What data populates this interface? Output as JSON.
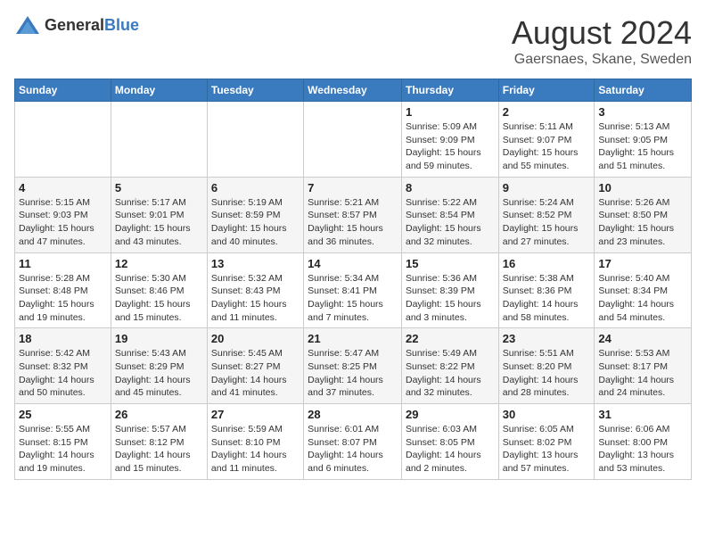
{
  "header": {
    "logo": {
      "general": "General",
      "blue": "Blue"
    },
    "title": "August 2024",
    "subtitle": "Gaersnaes, Skane, Sweden"
  },
  "calendar": {
    "days_of_week": [
      "Sunday",
      "Monday",
      "Tuesday",
      "Wednesday",
      "Thursday",
      "Friday",
      "Saturday"
    ],
    "weeks": [
      [
        {
          "day": "",
          "info": ""
        },
        {
          "day": "",
          "info": ""
        },
        {
          "day": "",
          "info": ""
        },
        {
          "day": "",
          "info": ""
        },
        {
          "day": "1",
          "info": "Sunrise: 5:09 AM\nSunset: 9:09 PM\nDaylight: 15 hours\nand 59 minutes."
        },
        {
          "day": "2",
          "info": "Sunrise: 5:11 AM\nSunset: 9:07 PM\nDaylight: 15 hours\nand 55 minutes."
        },
        {
          "day": "3",
          "info": "Sunrise: 5:13 AM\nSunset: 9:05 PM\nDaylight: 15 hours\nand 51 minutes."
        }
      ],
      [
        {
          "day": "4",
          "info": "Sunrise: 5:15 AM\nSunset: 9:03 PM\nDaylight: 15 hours\nand 47 minutes."
        },
        {
          "day": "5",
          "info": "Sunrise: 5:17 AM\nSunset: 9:01 PM\nDaylight: 15 hours\nand 43 minutes."
        },
        {
          "day": "6",
          "info": "Sunrise: 5:19 AM\nSunset: 8:59 PM\nDaylight: 15 hours\nand 40 minutes."
        },
        {
          "day": "7",
          "info": "Sunrise: 5:21 AM\nSunset: 8:57 PM\nDaylight: 15 hours\nand 36 minutes."
        },
        {
          "day": "8",
          "info": "Sunrise: 5:22 AM\nSunset: 8:54 PM\nDaylight: 15 hours\nand 32 minutes."
        },
        {
          "day": "9",
          "info": "Sunrise: 5:24 AM\nSunset: 8:52 PM\nDaylight: 15 hours\nand 27 minutes."
        },
        {
          "day": "10",
          "info": "Sunrise: 5:26 AM\nSunset: 8:50 PM\nDaylight: 15 hours\nand 23 minutes."
        }
      ],
      [
        {
          "day": "11",
          "info": "Sunrise: 5:28 AM\nSunset: 8:48 PM\nDaylight: 15 hours\nand 19 minutes."
        },
        {
          "day": "12",
          "info": "Sunrise: 5:30 AM\nSunset: 8:46 PM\nDaylight: 15 hours\nand 15 minutes."
        },
        {
          "day": "13",
          "info": "Sunrise: 5:32 AM\nSunset: 8:43 PM\nDaylight: 15 hours\nand 11 minutes."
        },
        {
          "day": "14",
          "info": "Sunrise: 5:34 AM\nSunset: 8:41 PM\nDaylight: 15 hours\nand 7 minutes."
        },
        {
          "day": "15",
          "info": "Sunrise: 5:36 AM\nSunset: 8:39 PM\nDaylight: 15 hours\nand 3 minutes."
        },
        {
          "day": "16",
          "info": "Sunrise: 5:38 AM\nSunset: 8:36 PM\nDaylight: 14 hours\nand 58 minutes."
        },
        {
          "day": "17",
          "info": "Sunrise: 5:40 AM\nSunset: 8:34 PM\nDaylight: 14 hours\nand 54 minutes."
        }
      ],
      [
        {
          "day": "18",
          "info": "Sunrise: 5:42 AM\nSunset: 8:32 PM\nDaylight: 14 hours\nand 50 minutes."
        },
        {
          "day": "19",
          "info": "Sunrise: 5:43 AM\nSunset: 8:29 PM\nDaylight: 14 hours\nand 45 minutes."
        },
        {
          "day": "20",
          "info": "Sunrise: 5:45 AM\nSunset: 8:27 PM\nDaylight: 14 hours\nand 41 minutes."
        },
        {
          "day": "21",
          "info": "Sunrise: 5:47 AM\nSunset: 8:25 PM\nDaylight: 14 hours\nand 37 minutes."
        },
        {
          "day": "22",
          "info": "Sunrise: 5:49 AM\nSunset: 8:22 PM\nDaylight: 14 hours\nand 32 minutes."
        },
        {
          "day": "23",
          "info": "Sunrise: 5:51 AM\nSunset: 8:20 PM\nDaylight: 14 hours\nand 28 minutes."
        },
        {
          "day": "24",
          "info": "Sunrise: 5:53 AM\nSunset: 8:17 PM\nDaylight: 14 hours\nand 24 minutes."
        }
      ],
      [
        {
          "day": "25",
          "info": "Sunrise: 5:55 AM\nSunset: 8:15 PM\nDaylight: 14 hours\nand 19 minutes."
        },
        {
          "day": "26",
          "info": "Sunrise: 5:57 AM\nSunset: 8:12 PM\nDaylight: 14 hours\nand 15 minutes."
        },
        {
          "day": "27",
          "info": "Sunrise: 5:59 AM\nSunset: 8:10 PM\nDaylight: 14 hours\nand 11 minutes."
        },
        {
          "day": "28",
          "info": "Sunrise: 6:01 AM\nSunset: 8:07 PM\nDaylight: 14 hours\nand 6 minutes."
        },
        {
          "day": "29",
          "info": "Sunrise: 6:03 AM\nSunset: 8:05 PM\nDaylight: 14 hours\nand 2 minutes."
        },
        {
          "day": "30",
          "info": "Sunrise: 6:05 AM\nSunset: 8:02 PM\nDaylight: 13 hours\nand 57 minutes."
        },
        {
          "day": "31",
          "info": "Sunrise: 6:06 AM\nSunset: 8:00 PM\nDaylight: 13 hours\nand 53 minutes."
        }
      ]
    ]
  }
}
